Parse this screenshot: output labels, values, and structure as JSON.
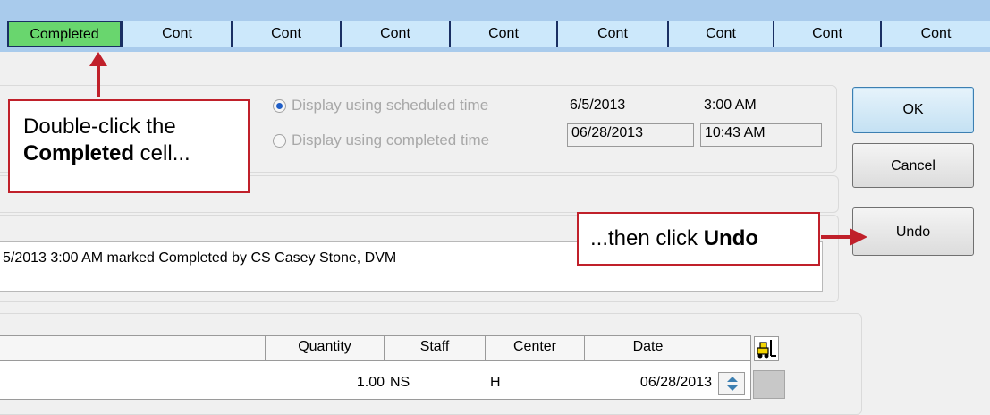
{
  "status_strip": {
    "cells": [
      "Completed",
      "Cont",
      "Cont",
      "Cont",
      "Cont",
      "Cont",
      "Cont",
      "Cont",
      "Cont"
    ]
  },
  "display_options": {
    "scheduled_label": "Display using scheduled time",
    "completed_label": "Display using completed time",
    "scheduled_date": "6/5/2013",
    "scheduled_time": "3:00 AM",
    "completed_date": "06/28/2013",
    "completed_time": "10:43 AM",
    "selected": "scheduled"
  },
  "buttons": {
    "ok": "OK",
    "cancel": "Cancel",
    "undo": "Undo"
  },
  "log": {
    "entry": "5/2013 3:00 AM marked Completed by  CS  Casey Stone, DVM"
  },
  "callouts": {
    "first": {
      "line1": "Double-click the",
      "bold": "Completed",
      "rest": " cell..."
    },
    "second": {
      "prefix": "...then click ",
      "bold": "Undo"
    }
  },
  "grid": {
    "headers": {
      "quantity": "Quantity",
      "staff": "Staff",
      "center": "Center",
      "date": "Date"
    },
    "row": {
      "quantity": "1.00",
      "staff": "NS",
      "center": "H",
      "date": "06/28/2013"
    }
  },
  "colors": {
    "callout_red": "#c0202a",
    "completed_green": "#69d66e",
    "strip_blue": "#cce8fb"
  }
}
